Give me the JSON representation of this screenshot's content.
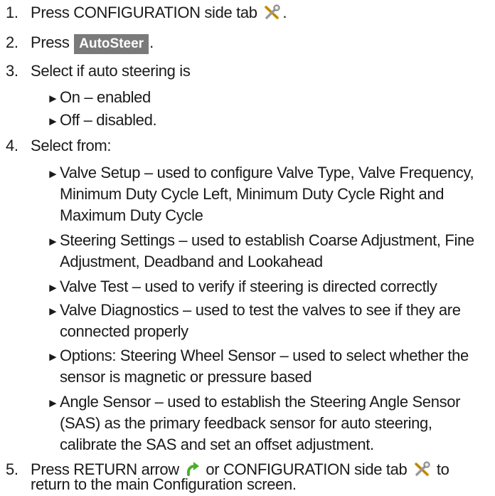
{
  "steps": [
    {
      "num": "1.",
      "pre": "Press CONFIGURATION side tab",
      "post": "."
    },
    {
      "num": "2.",
      "pre": "Press",
      "button": "AutoSteer",
      "post": "."
    },
    {
      "num": "3.",
      "text": "Select if auto steering is"
    },
    {
      "num": "4.",
      "text": "Select from:"
    },
    {
      "num": "5.",
      "pre": "Press RETURN arrow",
      "mid": "or CONFIGURATION side tab",
      "post": "to",
      "cont": "return to the main Configuration screen."
    }
  ],
  "step3_bullets": [
    "On – enabled",
    "Off – disabled."
  ],
  "step4_bullets": [
    [
      "Valve Setup – used to configure Valve Type, Valve Frequency,",
      "Minimum Duty Cycle Left, Minimum Duty Cycle Right and",
      "Maximum Duty Cycle"
    ],
    [
      "Steering Settings – used to establish Coarse Adjustment, Fine",
      "Adjustment, Deadband and Lookahead"
    ],
    [
      "Valve Test – used to verify if steering is directed correctly"
    ],
    [
      "Valve Diagnostics – used to test the valves to see if they are",
      "connected properly"
    ],
    [
      "Options: Steering Wheel Sensor – used to select whether the",
      "sensor is magnetic or pressure based"
    ],
    [
      "Angle Sensor – used to establish the Steering Angle Sensor",
      "(SAS)  as the primary feedback sensor for auto steering,",
      "calibrate the SAS and set an offset adjustment."
    ]
  ],
  "bullet_glyph": "►",
  "icons": {
    "config": "wrench-screwdriver-icon",
    "return": "green-return-arrow-icon"
  },
  "colors": {
    "text": "#1a1a1a",
    "button_bg": "#7a7a7a",
    "button_text": "#ffffff",
    "arrow_green": "#4caf2a"
  }
}
